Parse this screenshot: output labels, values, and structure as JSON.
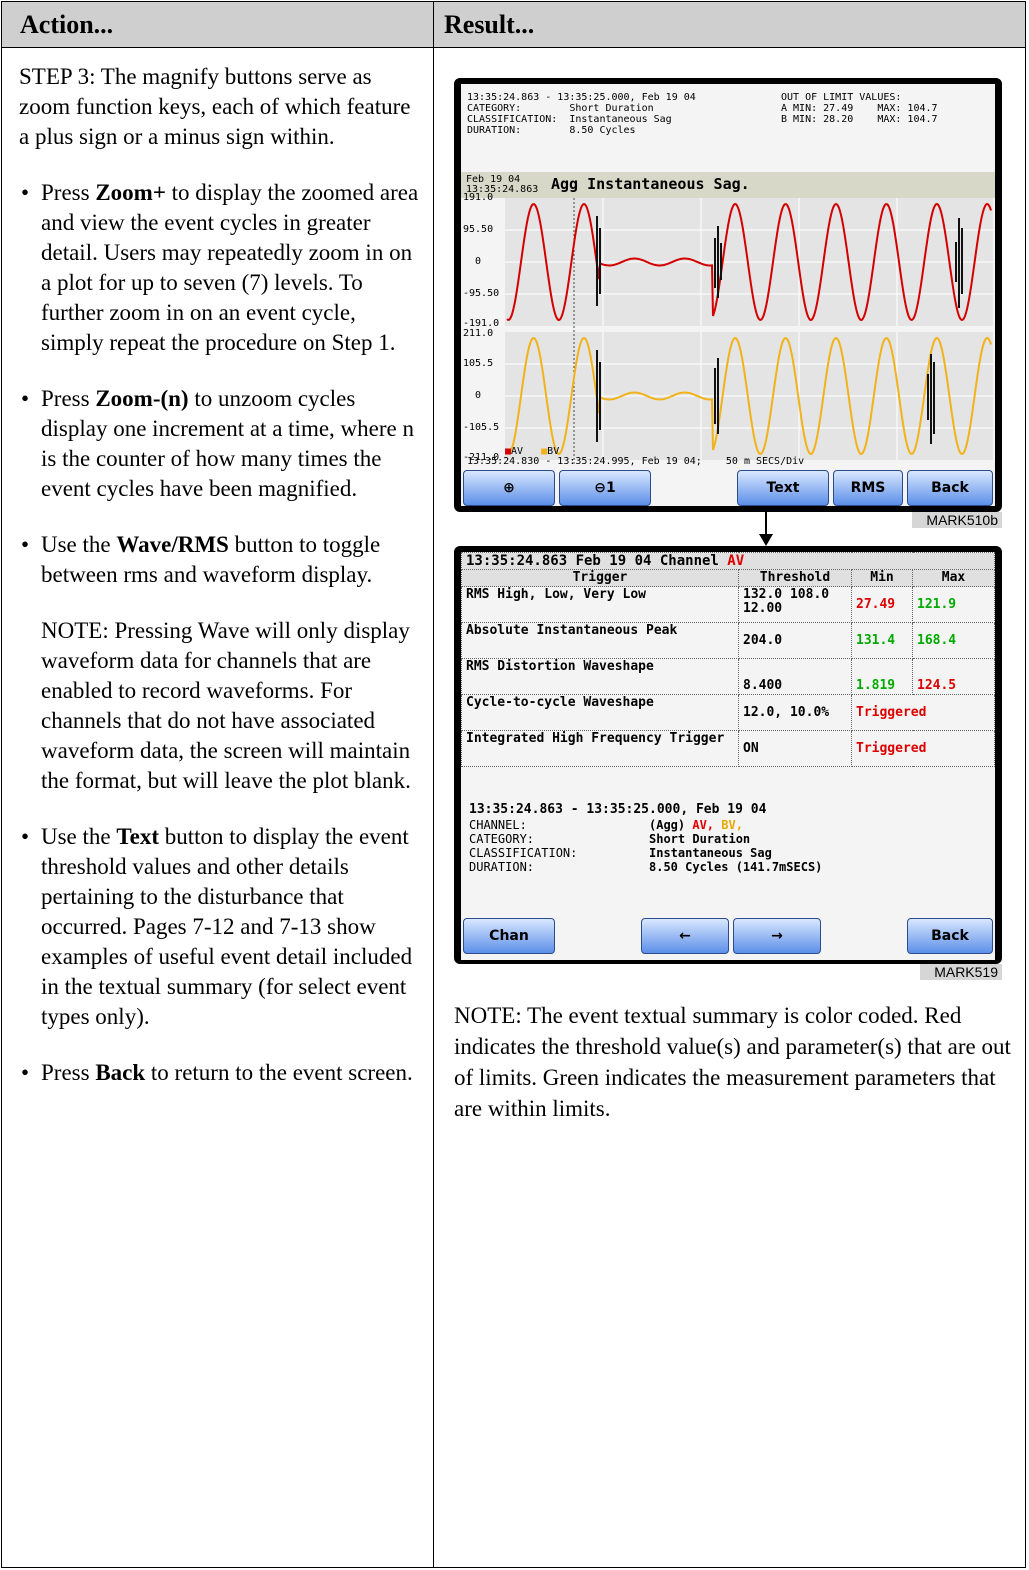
{
  "header": {
    "action": "Action...",
    "result": "Result..."
  },
  "left": {
    "step": "STEP 3: The magnify buttons serve as zoom function keys, each of which feature a plus sign or a minus sign within.",
    "b1_pre": "Press ",
    "b1_bold": "Zoom+",
    "b1_post": " to display the zoomed area and view the event cycles in greater detail. Users may repeatedly zoom in on a plot for up to seven (7) levels. To further zoom in on an event cycle, simply repeat the procedure on Step 1.",
    "b2_pre": "Press ",
    "b2_bold": "Zoom-(n)",
    "b2_post": " to unzoom cycles display one increment at a time, where n is the counter of how many times the event cycles have been magnified.",
    "b3_pre": "Use the ",
    "b3_bold": "Wave/RMS",
    "b3_post": " button to toggle between rms and waveform display.",
    "note": "NOTE: Pressing Wave will only display waveform data for channels that are enabled to record waveforms. For channels that do not have associated waveform data, the screen will maintain the format, but will leave the plot blank.",
    "b4_pre": "Use the ",
    "b4_bold": "Text",
    "b4_post": " button to display the event threshold values and other details pertaining to the disturbance that occurred. Pages 7-12 and 7-13 show examples of useful event detail included in the textual summary (for select event types only).",
    "b5_pre": "Press ",
    "b5_bold": "Back",
    "b5_post": " to return to the event screen."
  },
  "screen1": {
    "hdr_left": "13:35:24.863 - 13:35:25.000, Feb 19 04\nCATEGORY:        Short Duration\nCLASSIFICATION:  Instantaneous Sag\nDURATION:        8.50 Cycles",
    "hdr_right": "OUT OF LIMIT VALUES:\nA MIN: 27.49    MAX: 104.7\nB MIN: 28.20    MAX: 104.7",
    "title_date": "Feb 19 04\n13:35:24.863",
    "title": "Agg Instantaneous Sag.",
    "yA": [
      "191.0",
      "95.50",
      "0",
      "-95.50",
      "-191.0"
    ],
    "yB": [
      "211.0",
      "105.5",
      "0",
      "-105.5",
      "-211.0"
    ],
    "legend_av": "AV",
    "legend_bv": "BV",
    "time_line": "13:35:24.830 - 13:35:24.995, Feb 19 04;    50 m SECS/Div",
    "btn_zoom_in": "⊕",
    "btn_zoom_out": "⊖1",
    "btn_text": "Text",
    "btn_rms": "RMS",
    "btn_back": "Back",
    "caption": "MARK510b",
    "color_av": "#d40000",
    "color_bv": "#f2b21a"
  },
  "screen2": {
    "head_line": "13:35:24.863  Feb 19 04 Channel ",
    "head_channel": "AV",
    "col_trigger": "Trigger",
    "col_threshold": "Threshold",
    "col_min": "Min",
    "col_max": "Max",
    "r1_trigger": "RMS High, Low, Very Low",
    "r1_threshold": "132.0 108.0 12.00",
    "r1_min": "27.49",
    "r1_max": "121.9",
    "r2_trigger": "Absolute Instantaneous Peak",
    "r2_threshold": "204.0",
    "r2_min": "131.4",
    "r2_max": "168.4",
    "r3_trigger": "RMS Distortion Waveshape",
    "r3_threshold": "8.400",
    "r3_min": "1.819",
    "r3_max": "124.5",
    "r4_trigger": "Cycle-to-cycle Waveshape",
    "r4_threshold": "12.0, 10.0%",
    "r4_status": "Triggered",
    "r5_trigger": "Integrated High Frequency Trigger",
    "r5_threshold": "ON",
    "r5_status": "Triggered",
    "sum_time": "13:35:24.863 - 13:35:25.000, Feb 19 04",
    "sum_channel_label": "CHANNEL:",
    "sum_channel_agg": "(Agg) ",
    "sum_channel_av": "AV,",
    "sum_channel_bv": "BV,",
    "sum_category_label": "CATEGORY:",
    "sum_category": "Short Duration",
    "sum_class_label": "CLASSIFICATION:",
    "sum_class": "Instantaneous Sag",
    "sum_duration_label": "DURATION:",
    "sum_duration": "8.50 Cycles (141.7mSECS)",
    "btn_chan": "Chan",
    "btn_prev": "←",
    "btn_next": "→",
    "btn_back": "Back",
    "caption": "MARK519"
  },
  "right_note": "NOTE: The event textual summary is color coded. Red indicates the threshold value(s) and parameter(s) that are out of limits. Green indicates the measurement parameters that are within limits."
}
